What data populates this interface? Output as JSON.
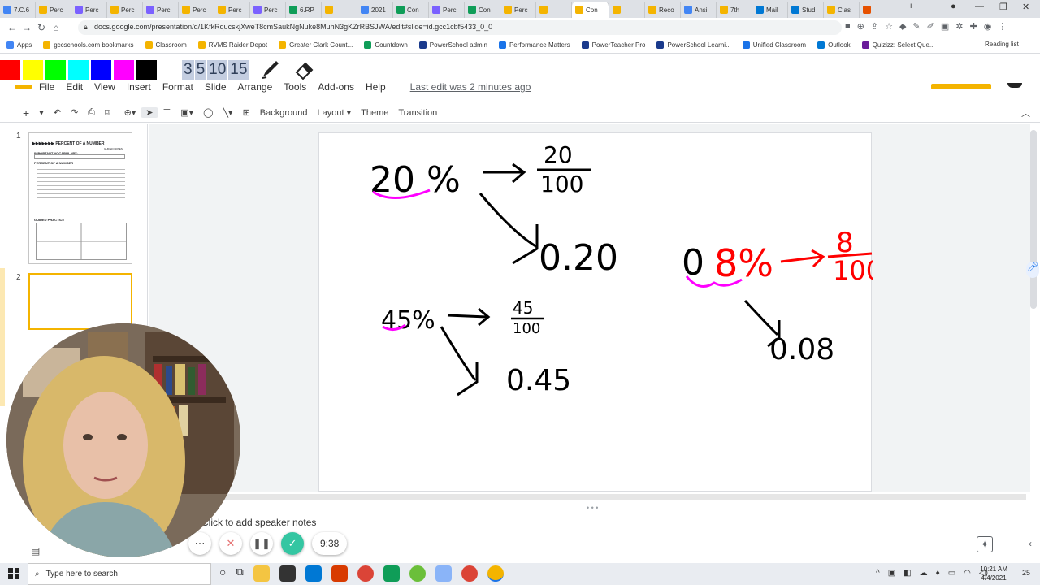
{
  "browser": {
    "tabs": [
      {
        "label": "7.C.6",
        "color": "#4285f4"
      },
      {
        "label": "Perc",
        "color": "#f4b400"
      },
      {
        "label": "Perc",
        "color": "#7b61ff"
      },
      {
        "label": "Perc",
        "color": "#f4b400"
      },
      {
        "label": "Perc",
        "color": "#7b61ff"
      },
      {
        "label": "Perc",
        "color": "#f4b400"
      },
      {
        "label": "Perc",
        "color": "#f4b400"
      },
      {
        "label": "Perc",
        "color": "#7b61ff"
      },
      {
        "label": "6.RP",
        "color": "#0f9d58"
      },
      {
        "label": "",
        "color": "#f4b400"
      },
      {
        "label": "2021",
        "color": "#4285f4"
      },
      {
        "label": "Con",
        "color": "#0f9d58"
      },
      {
        "label": "Perc",
        "color": "#7b61ff"
      },
      {
        "label": "Con",
        "color": "#0f9d58"
      },
      {
        "label": "Perc",
        "color": "#f4b400"
      },
      {
        "label": "",
        "color": "#f4b400"
      },
      {
        "label": "Con",
        "color": "#f4b400"
      },
      {
        "label": "",
        "color": "#f4b400"
      },
      {
        "label": "Reco",
        "color": "#f4b400"
      },
      {
        "label": "Ansi",
        "color": "#4285f4"
      },
      {
        "label": "7th",
        "color": "#f4b400"
      },
      {
        "label": "Mail",
        "color": "#0078d4"
      },
      {
        "label": "Stud",
        "color": "#0078d4"
      },
      {
        "label": "Clas",
        "color": "#f4b400"
      },
      {
        "label": "",
        "color": "#e65100"
      }
    ],
    "url": "docs.google.com/presentation/d/1KfkRqucskjXweT8cmSaukNgNuke8MuhN3gKZrRBSJWA/edit#slide=id.gcc1cbf5433_0_0",
    "bookmarks": [
      "Apps",
      "gccschools.com bookmarks",
      "Classroom",
      "RVMS Raider Depot",
      "Greater Clark Count...",
      "Countdown",
      "PowerSchool admin",
      "Performance Matters",
      "PowerTeacher Pro",
      "PowerSchool Learni...",
      "Unified Classroom",
      "Outlook",
      "Quizizz: Select Que..."
    ],
    "reading_list": "Reading list"
  },
  "annotation_toolbar": {
    "colors": [
      "#ff0000",
      "#ffff00",
      "#00ff00",
      "#00ffff",
      "#0000ff",
      "#ff00ff",
      "#000000"
    ],
    "numbers": [
      "3",
      "5",
      "10",
      "15"
    ]
  },
  "menu": {
    "items": [
      "File",
      "Edit",
      "View",
      "Insert",
      "Format",
      "Slide",
      "Arrange",
      "Tools",
      "Add-ons",
      "Help"
    ],
    "last_edit": "Last edit was 2 minutes ago"
  },
  "toolbar": {
    "background": "Background",
    "layout": "Layout",
    "theme": "Theme",
    "transition": "Transition"
  },
  "filmstrip": {
    "slides": [
      {
        "number": "1",
        "title": "PERCENT OF A NUMBER",
        "subtitle": "GUIDED NOTES",
        "heading1": "IMPORTANT VOCABULARY:",
        "heading2": "PERCENT OF A NUMBER",
        "heading3": "GUIDED PRACTICE"
      },
      {
        "number": "2"
      }
    ]
  },
  "slide_content": {
    "ex1": {
      "percent": "20 %",
      "numerator": "20",
      "denominator": "100",
      "decimal": "0.20"
    },
    "ex2": {
      "percent": "45%",
      "numerator": "45",
      "denominator": "100",
      "decimal": "0.45"
    },
    "ex3": {
      "prefix": "0",
      "percent": "8%",
      "numerator": "8",
      "denominator": "100",
      "decimal": "0.08"
    }
  },
  "notes": {
    "placeholder": "Click to add speaker notes"
  },
  "recorder": {
    "time": "9:38"
  },
  "taskbar": {
    "search_placeholder": "Type here to search",
    "time": "10:21 AM",
    "date": "4/4/2021",
    "notifications": "25"
  }
}
